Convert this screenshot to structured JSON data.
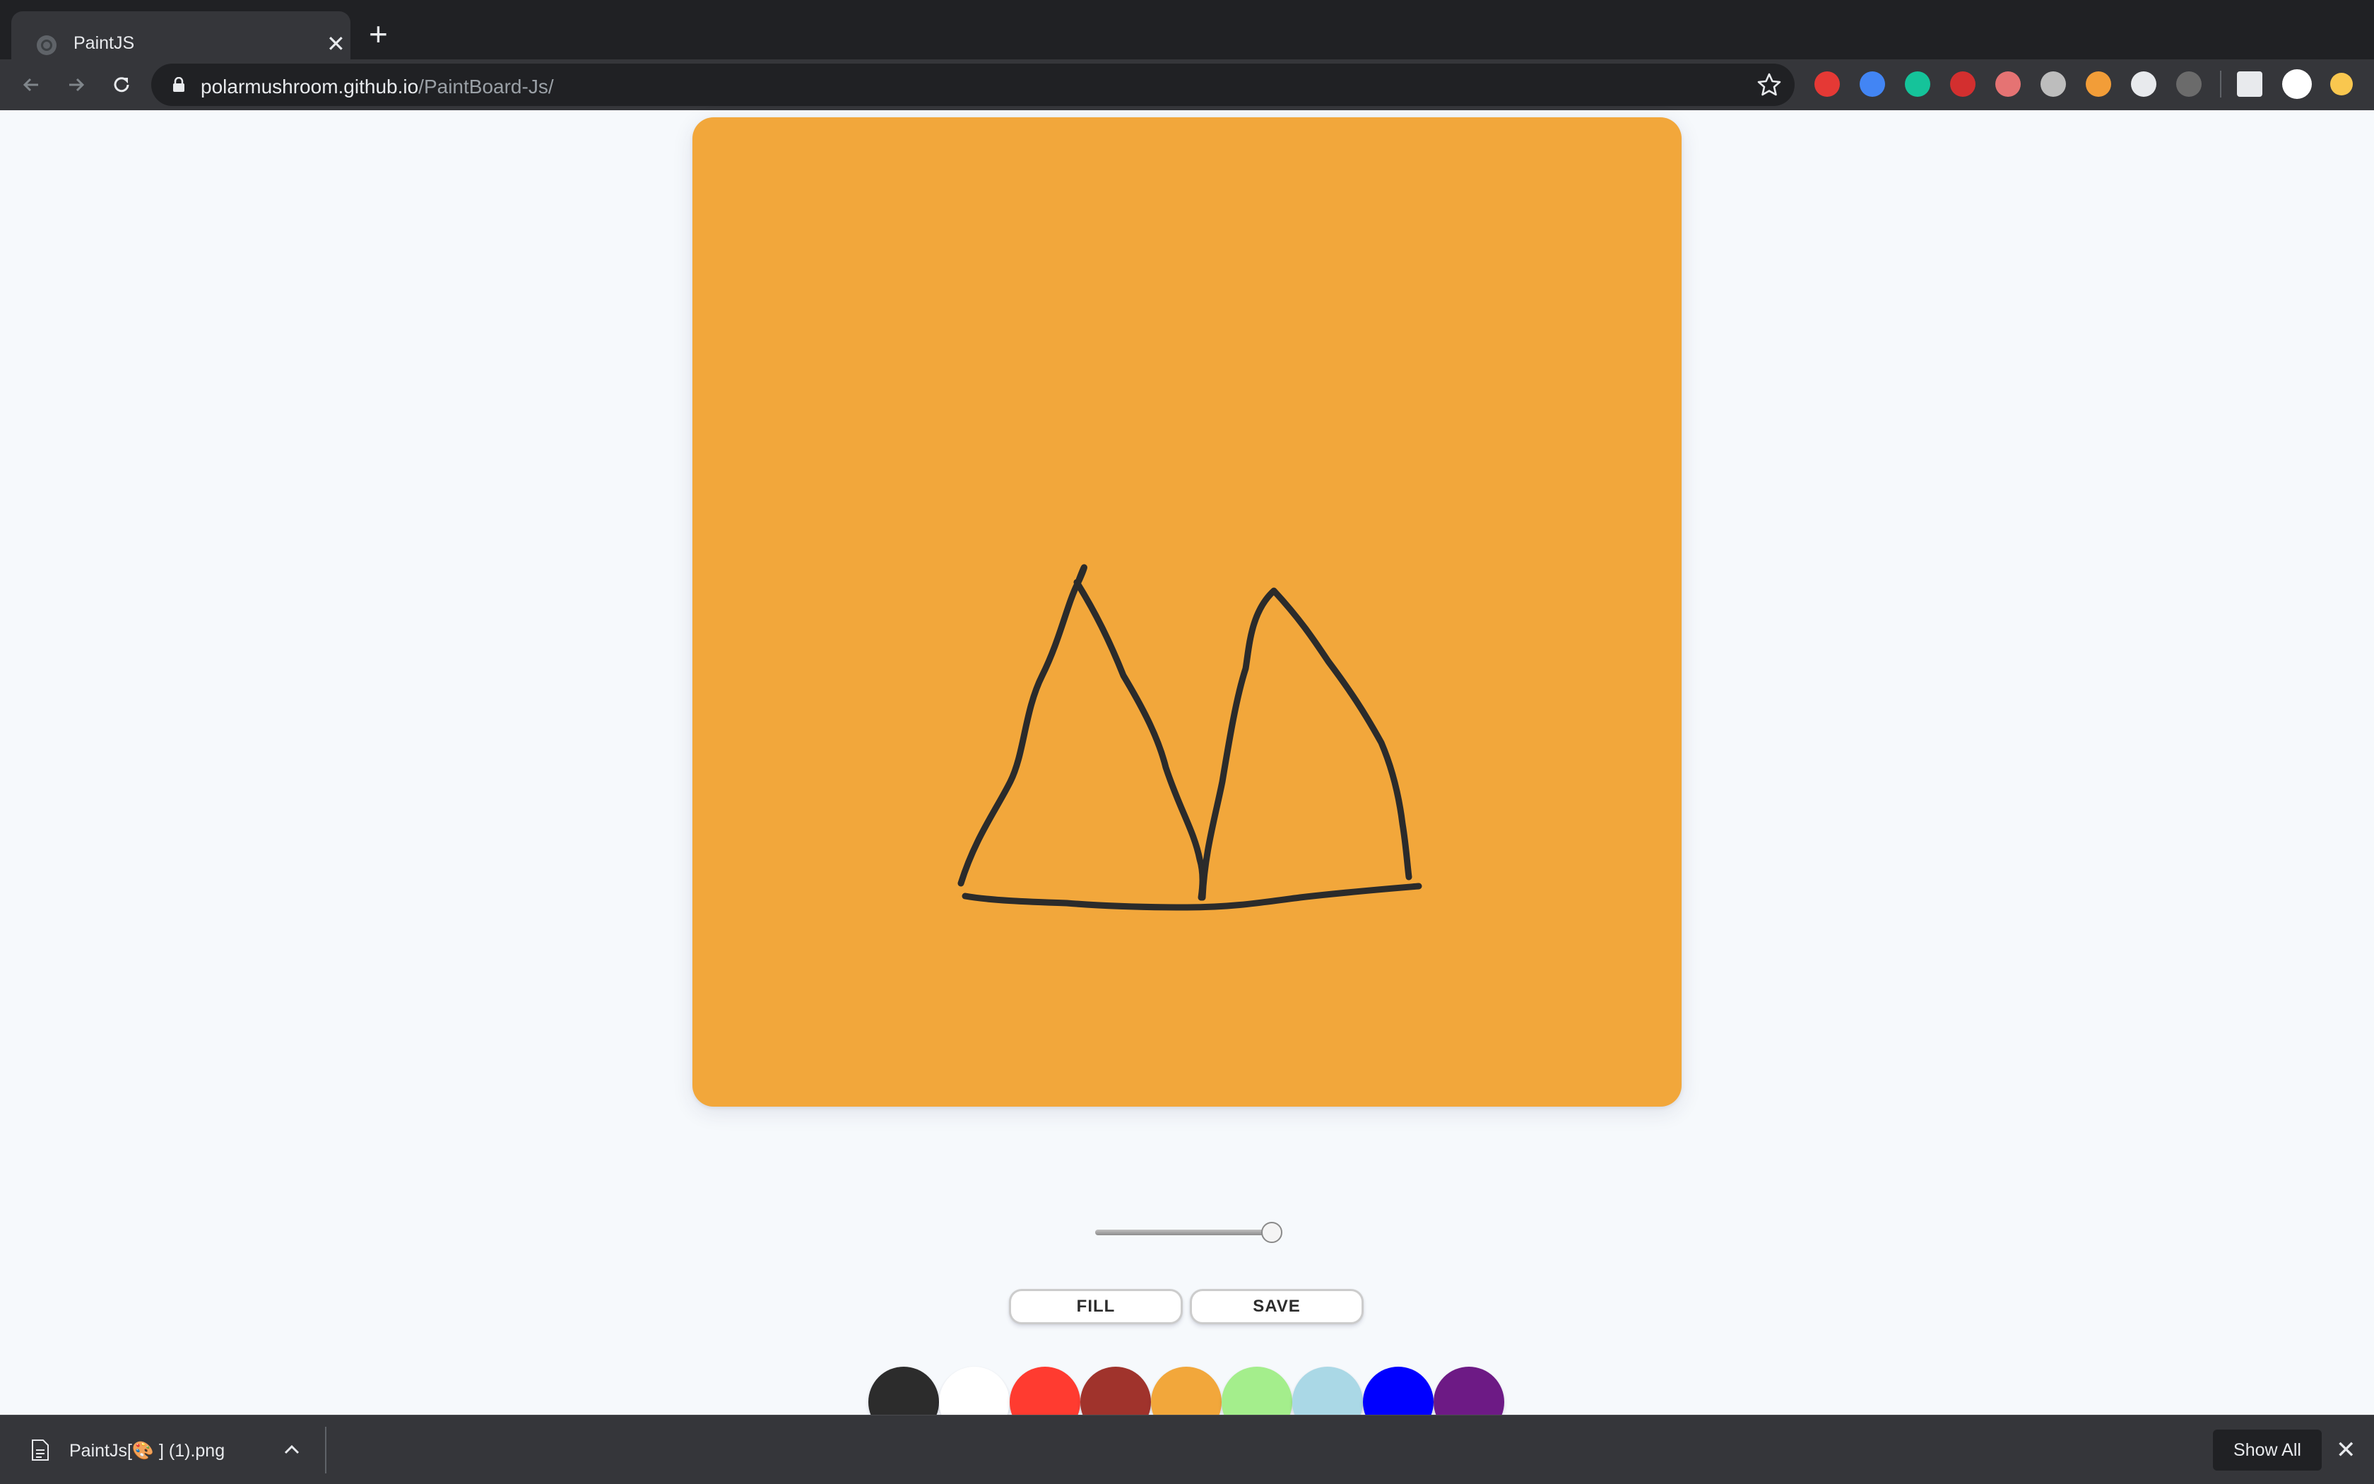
{
  "browser": {
    "tab": {
      "title": "PaintJS",
      "favicon": "globe-icon",
      "close": "✕"
    },
    "new_tab": "+",
    "address": {
      "host": "polarmushroom.github.io",
      "path": "/PaintBoard-Js/"
    },
    "extensions": [
      {
        "name": "hand-stop-extension-icon",
        "color": "#e53935"
      },
      {
        "name": "pinwheel-extension-icon",
        "color": "#4285f4"
      },
      {
        "name": "grammarly-extension-icon",
        "color": "#15c39a"
      },
      {
        "name": "redirect-extension-icon",
        "color": "#d32f2f"
      },
      {
        "name": "eyedropper-extension-icon",
        "color": "#e57373"
      },
      {
        "name": "speedometer-extension-icon",
        "color": "#bdbdbd"
      },
      {
        "name": "lambda-extension-icon",
        "color": "#f29d38"
      },
      {
        "name": "react-devtools-extension-icon",
        "color": "#e8eaed"
      },
      {
        "name": "json-extension-icon",
        "color": "#6b6b6b"
      },
      {
        "name": "media-queue-icon",
        "color": "#e8eaed"
      },
      {
        "name": "profile-avatar",
        "color": "#ffffff"
      },
      {
        "name": "update-badge-icon",
        "color": "#f9c74f"
      }
    ]
  },
  "paint": {
    "canvas_color": "#f2a73b",
    "brush_size_fraction": 1.0,
    "buttons": {
      "fill": "FILL",
      "save": "SAVE"
    },
    "palette": [
      {
        "name": "black",
        "color": "#2c2c2c"
      },
      {
        "name": "white",
        "color": "#ffffff"
      },
      {
        "name": "red",
        "color": "#ff3b30"
      },
      {
        "name": "brown",
        "color": "#a0332c"
      },
      {
        "name": "orange",
        "color": "#f2a73b"
      },
      {
        "name": "light-green",
        "color": "#a4ee8c"
      },
      {
        "name": "light-blue",
        "color": "#aad8e6"
      },
      {
        "name": "blue",
        "color": "#0000ff"
      },
      {
        "name": "purple",
        "color": "#6d1a85"
      }
    ]
  },
  "downloads": {
    "file_name": "PaintJs[🎨 ] (1).png",
    "show_all": "Show All",
    "close": "✕"
  }
}
